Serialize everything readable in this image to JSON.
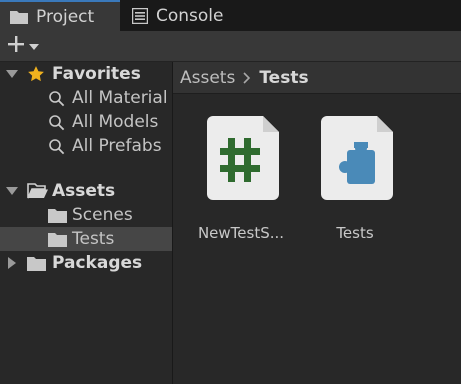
{
  "tabs": [
    {
      "label": "Project",
      "icon": "folder-icon",
      "active": true
    },
    {
      "label": "Console",
      "icon": "console-icon",
      "active": false
    }
  ],
  "toolbar": {
    "add_icon": "plus-icon",
    "dropdown_icon": "chevron-down-icon"
  },
  "tree": {
    "favorites": {
      "label": "Favorites",
      "items": [
        {
          "label": "All Material",
          "icon": "search-icon"
        },
        {
          "label": "All Models",
          "icon": "search-icon"
        },
        {
          "label": "All Prefabs",
          "icon": "search-icon"
        }
      ]
    },
    "assets": {
      "label": "Assets",
      "children": [
        {
          "label": "Scenes",
          "icon": "folder-icon",
          "selected": false
        },
        {
          "label": "Tests",
          "icon": "folder-icon",
          "selected": true
        }
      ]
    },
    "packages": {
      "label": "Packages"
    }
  },
  "breadcrumb": {
    "root": "Assets",
    "current": "Tests"
  },
  "assets_grid": [
    {
      "name": "NewTestS...",
      "icon": "csharp-script-icon"
    },
    {
      "name": "Tests",
      "icon": "assembly-definition-icon"
    }
  ],
  "colors": {
    "accent": "#3a79bb",
    "favorites_star": "#f0b11e",
    "script_hash": "#2f6b2f",
    "assembly_piece": "#4a8ab8"
  }
}
